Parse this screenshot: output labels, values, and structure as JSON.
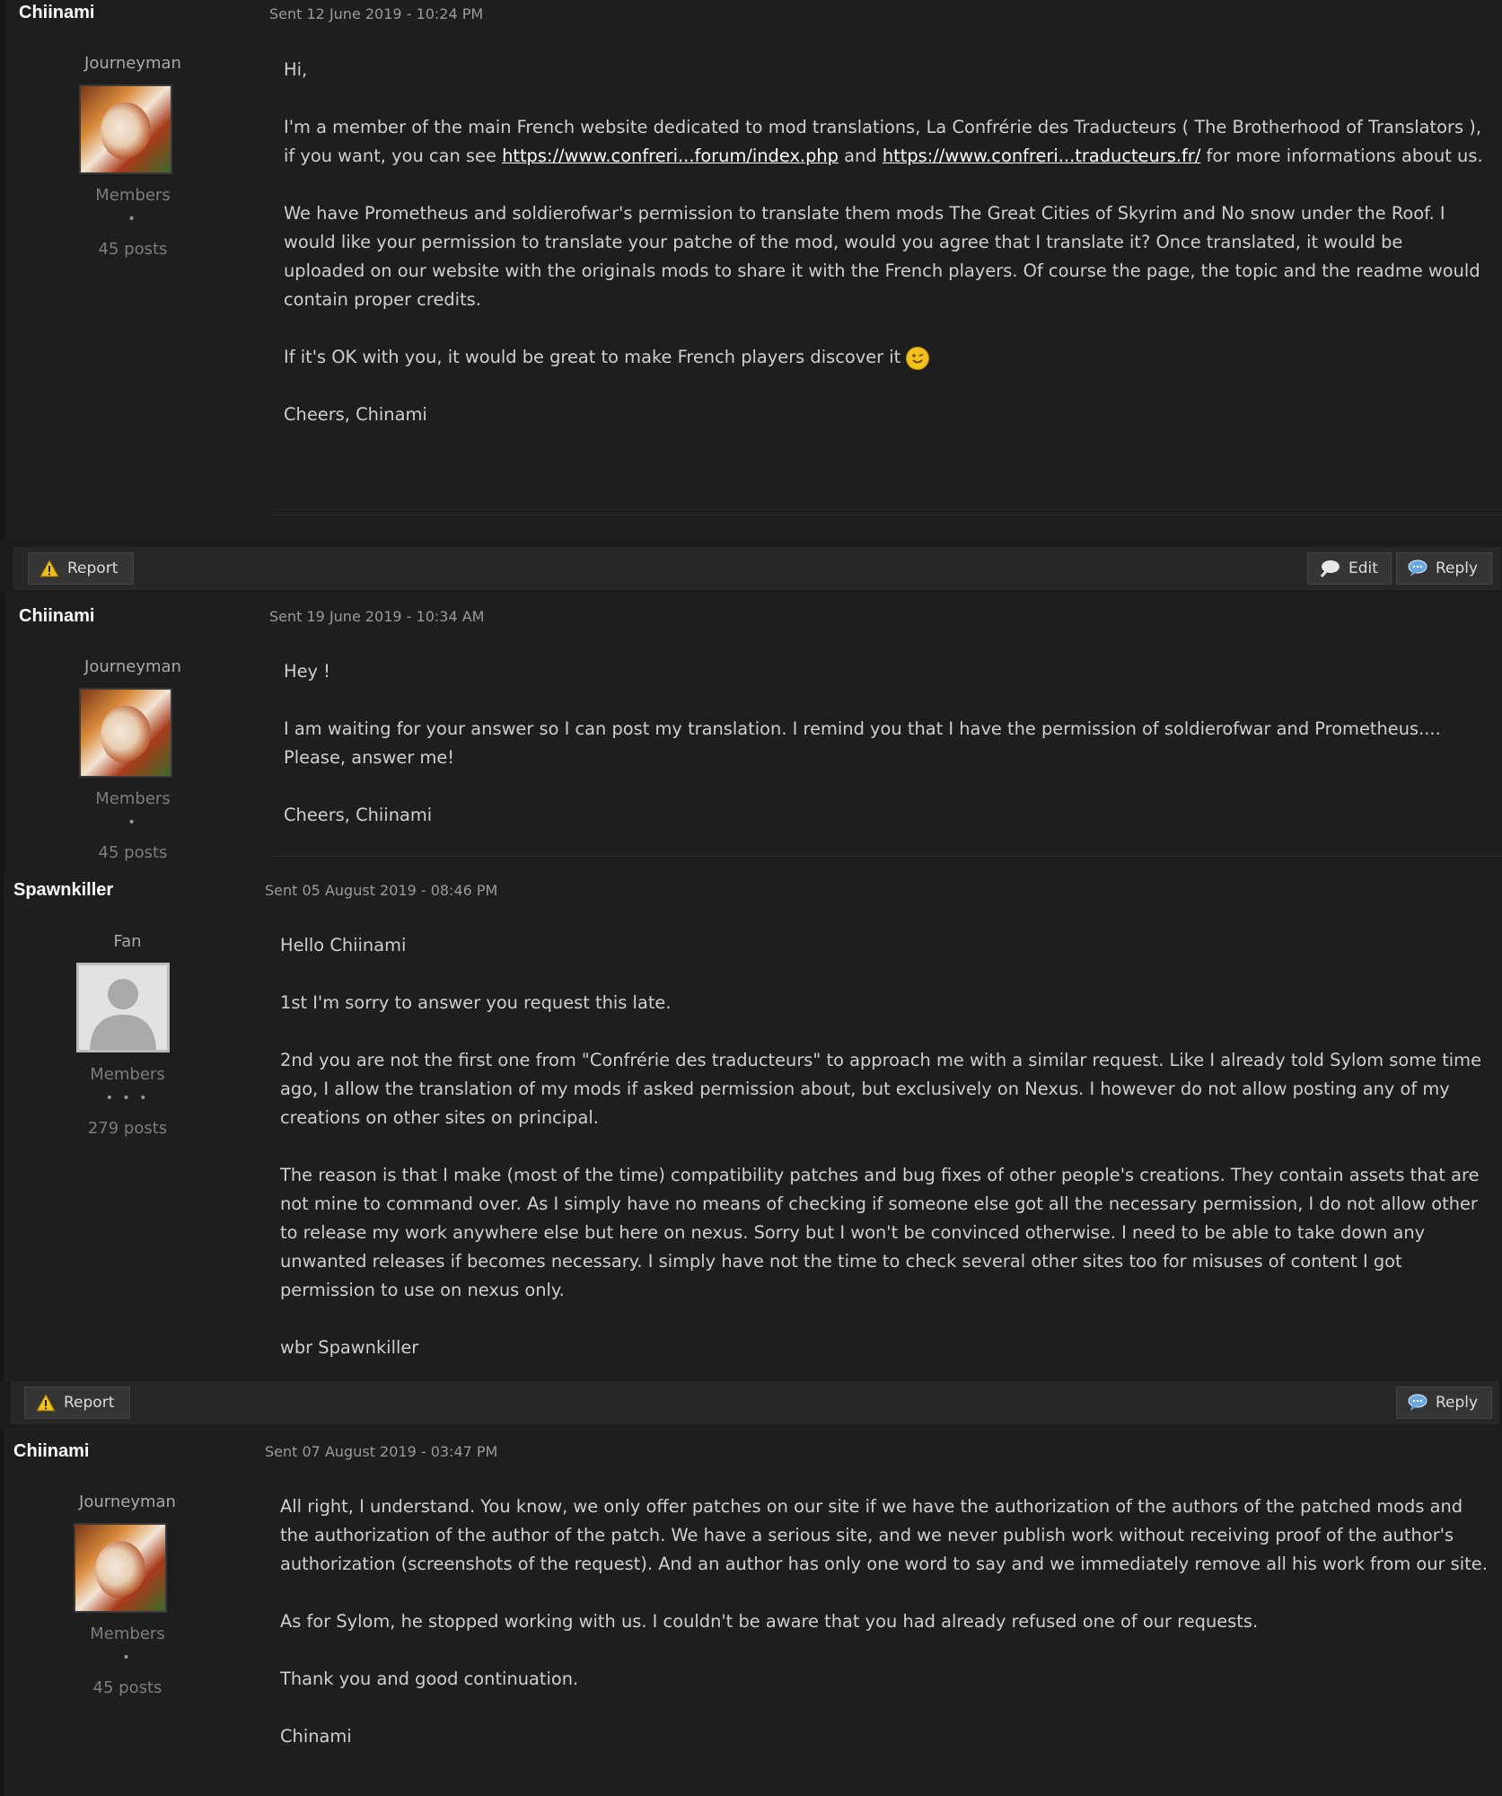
{
  "posts": [
    {
      "author": "Chiinami",
      "sent": "Sent 12 June 2019 - 10:24 PM",
      "rank": "Journeyman",
      "group": "Members",
      "pips": "•",
      "posts": "45 posts",
      "avatar": "anime-avatar",
      "paragraphs": [
        "Hi,",
        "I'm a member of the main French website dedicated to mod translations, La Confrérie des Traducteurs ( The Brotherhood of Translators ), if you want, you can see",
        "We have Prometheus and soldierofwar's permission to translate them mods The Great Cities of Skyrim and No snow under the Roof. I would like your permission to translate your patche of the mod, would you agree that I translate it? Once translated, it would be uploaded on our website with the originals mods to share it with the French players. Of course the page, the topic and the readme would contain proper credits.",
        "If it's OK with you, it would be great to make French players discover it",
        "Cheers, Chinami"
      ],
      "link1": "https://www.confreri...forum/index.php",
      "and_text": "and",
      "link2": "https://www.confreri...traducteurs.fr/",
      "after_links": "for more informations about us.",
      "emoji": "wink-smiley-icon"
    },
    {
      "author": "Chiinami",
      "sent": "Sent 19 June 2019 - 10:34 AM",
      "rank": "Journeyman",
      "group": "Members",
      "pips": "•",
      "posts": "45 posts",
      "avatar": "anime-avatar",
      "paragraphs": [
        "Hey !",
        "I am waiting for your answer so I can post my translation. I remind you that I have the permission of soldierofwar and Prometheus.... Please, answer me!",
        "Cheers, Chiinami"
      ]
    },
    {
      "author": "Spawnkiller",
      "sent": "Sent 05 August 2019 - 08:46 PM",
      "rank": "Fan",
      "group": "Members",
      "pips": "• • •",
      "posts": "279 posts",
      "avatar": "default-user-avatar",
      "paragraphs": [
        " Hello Chiinami",
        "1st I'm sorry to answer you request this late.",
        "2nd you are not the first one from \"Confrérie des traducteurs\" to approach me with a similar request. Like I already told Sylom some time ago, I allow the translation of my mods if asked permission about, but exclusively on Nexus. I however do not allow posting any of my creations on other sites on principal.",
        "The reason is that I make (most of the time) compatibility patches and bug fixes of other people's creations. They contain assets that are not mine to command over. As I simply have no means of checking if someone else got all the necessary permission, I do not allow other to release my work anywhere else but here on nexus. Sorry but I won't be convinced otherwise. I need to be able to take down any unwanted releases if becomes necessary. I simply have not the time to check several other sites too for misuses of content I got permission to use on nexus only.",
        "wbr Spawnkiller"
      ]
    },
    {
      "author": "Chiinami",
      "sent": "Sent 07 August 2019 - 03:47 PM",
      "rank": "Journeyman",
      "group": "Members",
      "pips": "•",
      "posts": "45 posts",
      "avatar": "anime-avatar",
      "paragraphs": [
        "All right, I understand. You know, we only offer patches on our site if we have the authorization of the authors of the patched mods and the authorization of the author of the patch. We have a serious site, and we never publish work without receiving proof of the author's authorization (screenshots of the request). And an author has only one word to say and we immediately remove all his work from our site.",
        "As for Sylom, he stopped working with us. I couldn't be aware that you had already refused one of our requests.",
        "Thank you and good continuation.",
        "Chinami"
      ]
    }
  ],
  "buttons": {
    "report": "Report",
    "edit": "Edit",
    "reply": "Reply"
  },
  "colors": {
    "background": "#1c1c1c",
    "text": "#cfcfcf",
    "link": "#ffffff",
    "warning": "#f2c21b"
  }
}
